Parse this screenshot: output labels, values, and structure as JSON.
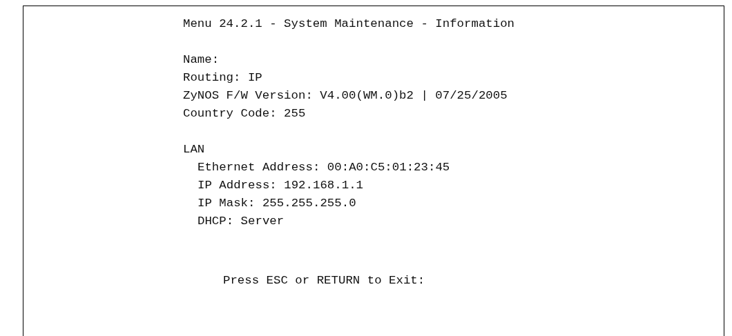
{
  "title": "Menu 24.2.1 - System Maintenance - Information",
  "info_lines": [
    "Name:",
    "Routing: IP",
    "ZyNOS F/W Version: V4.00(WM.0)b2 | 07/25/2005",
    "Country Code: 255"
  ],
  "lan": {
    "heading": "LAN",
    "lines": [
      "Ethernet Address: 00:A0:C5:01:23:45",
      "IP Address: 192.168.1.1",
      "IP Mask: 255.255.255.0",
      "DHCP: Server"
    ]
  },
  "prompt": "Press ESC or RETURN to Exit:"
}
